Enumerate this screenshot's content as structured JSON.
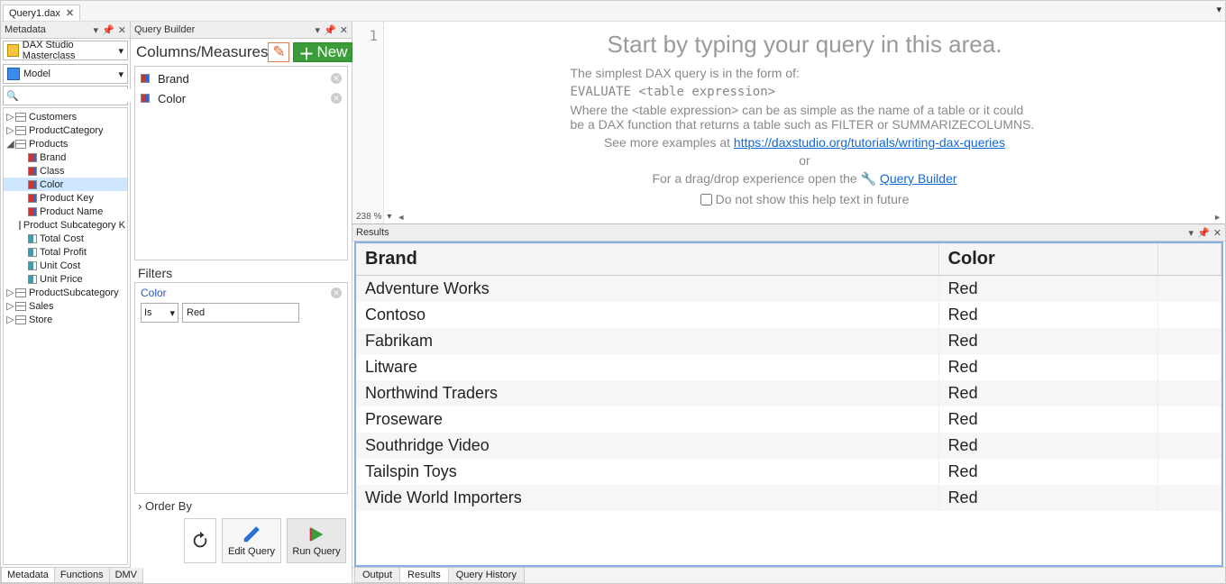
{
  "file_tab": {
    "name": "Query1.dax",
    "close": "✕"
  },
  "metadata": {
    "title": "Metadata",
    "database": "DAX Studio Masterclass",
    "model": "Model",
    "search_placeholder": "",
    "tabs": [
      "Metadata",
      "Functions",
      "DMV"
    ],
    "tree": [
      {
        "type": "table",
        "name": "Customers",
        "expand": "▷",
        "depth": 0
      },
      {
        "type": "table",
        "name": "ProductCategory",
        "expand": "▷",
        "depth": 0
      },
      {
        "type": "table",
        "name": "Products",
        "expand": "◢",
        "depth": 0
      },
      {
        "type": "col",
        "name": "Brand",
        "depth": 1
      },
      {
        "type": "col",
        "name": "Class",
        "depth": 1
      },
      {
        "type": "col",
        "name": "Color",
        "depth": 1,
        "selected": true
      },
      {
        "type": "col",
        "name": "Product Key",
        "depth": 1
      },
      {
        "type": "col",
        "name": "Product Name",
        "depth": 1
      },
      {
        "type": "col",
        "name": "Product Subcategory K",
        "depth": 1
      },
      {
        "type": "meas",
        "name": "Total Cost",
        "depth": 1
      },
      {
        "type": "meas",
        "name": "Total Profit",
        "depth": 1
      },
      {
        "type": "meas",
        "name": "Unit Cost",
        "depth": 1
      },
      {
        "type": "meas",
        "name": "Unit Price",
        "depth": 1
      },
      {
        "type": "table",
        "name": "ProductSubcategory",
        "expand": "▷",
        "depth": 0
      },
      {
        "type": "table",
        "name": "Sales",
        "expand": "▷",
        "depth": 0
      },
      {
        "type": "table",
        "name": "Store",
        "expand": "▷",
        "depth": 0
      }
    ]
  },
  "qb": {
    "title": "Query Builder",
    "columns_title": "Columns/Measures",
    "new_label": "New",
    "columns": [
      {
        "name": "Brand"
      },
      {
        "name": "Color"
      }
    ],
    "filters_title": "Filters",
    "filter": {
      "field": "Color",
      "op": "Is",
      "value": "Red"
    },
    "orderby_label": "Order By",
    "edit_query": "Edit Query",
    "run_query": "Run Query"
  },
  "editor": {
    "line_no": "1",
    "headline": "Start by typing your query in this area.",
    "p1": "The simplest DAX query is in the form of:",
    "code": "EVALUATE <table expression>",
    "p2": "Where the <table expression> can be as simple as the name of a table or it could be a DAX function that returns a table such as FILTER or SUMMARIZECOLUMNS.",
    "p3a": "See more examples at ",
    "link1": "https://daxstudio.org/tutorials/writing-dax-queries",
    "or": "or",
    "p4a": "For a drag/drop experience open the ",
    "link2": "Query Builder",
    "do_not": "Do not show this help text in future",
    "zoom": "238 %"
  },
  "results": {
    "title": "Results",
    "tabs": [
      "Output",
      "Results",
      "Query History"
    ],
    "columns": [
      "Brand",
      "Color"
    ],
    "rows": [
      [
        "Adventure Works",
        "Red"
      ],
      [
        "Contoso",
        "Red"
      ],
      [
        "Fabrikam",
        "Red"
      ],
      [
        "Litware",
        "Red"
      ],
      [
        "Northwind Traders",
        "Red"
      ],
      [
        "Proseware",
        "Red"
      ],
      [
        "Southridge Video",
        "Red"
      ],
      [
        "Tailspin Toys",
        "Red"
      ],
      [
        "Wide World Importers",
        "Red"
      ]
    ]
  }
}
